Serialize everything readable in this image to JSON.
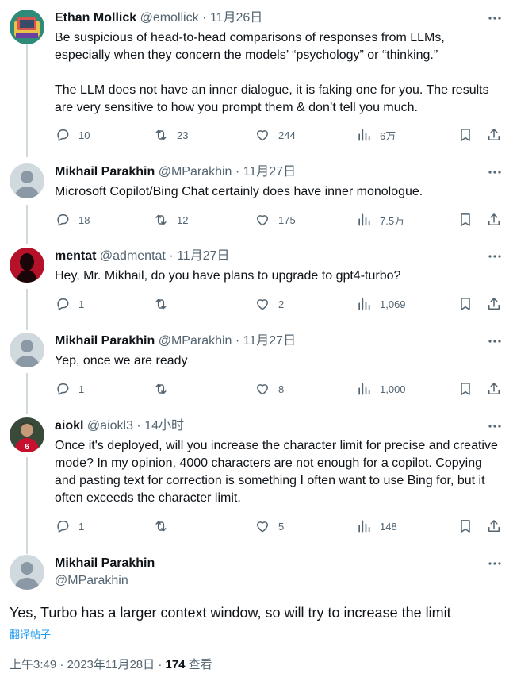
{
  "tweets": [
    {
      "name": "Ethan Mollick",
      "handle": "@emollick",
      "dot": "·",
      "time": "11月26日",
      "paragraphs": [
        "Be suspicious of head-to-head comparisons of responses from LLMs, especially when they concern the models’ “psychology” or “thinking.”",
        "The LLM does not have an inner dialogue, it is faking one for you. The results are very sensitive to how you prompt them & don’t tell you much."
      ],
      "replies": "10",
      "retweets": "23",
      "likes": "244",
      "views": "6万"
    },
    {
      "name": "Mikhail Parakhin",
      "handle": "@MParakhin",
      "dot": "·",
      "time": "11月27日",
      "paragraphs": [
        "Microsoft Copilot/Bing Chat certainly does have inner monologue."
      ],
      "replies": "18",
      "retweets": "12",
      "likes": "175",
      "views": "7.5万"
    },
    {
      "name": "mentat",
      "handle": "@admentat",
      "dot": "·",
      "time": "11月27日",
      "paragraphs": [
        "Hey, Mr. Mikhail, do you have plans to upgrade to gpt4-turbo?"
      ],
      "replies": "1",
      "retweets": "",
      "likes": "2",
      "views": "1,069"
    },
    {
      "name": "Mikhail Parakhin",
      "handle": "@MParakhin",
      "dot": "·",
      "time": "11月27日",
      "paragraphs": [
        "Yep, once we are ready"
      ],
      "replies": "1",
      "retweets": "",
      "likes": "8",
      "views": "1,000"
    },
    {
      "name": "aiokl",
      "handle": "@aiokl3",
      "dot": "·",
      "time": "14小时",
      "paragraphs": [
        "Once it's deployed, will you increase the character limit for precise and creative mode? In my opinion, 4000 characters are not enough for a copilot. Copying and pasting text for correction is something I often want to use Bing for, but it often exceeds the character limit."
      ],
      "replies": "1",
      "retweets": "",
      "likes": "5",
      "views": "148"
    }
  ],
  "main": {
    "name": "Mikhail Parakhin",
    "handle": "@MParakhin",
    "text": "Yes, Turbo has a larger context window, so will try to increase the limit",
    "translate": "翻译帖子",
    "time": "上午3:49 · 2023年11月28日 · ",
    "views_count": "174",
    "views_label": " 查看"
  },
  "icons": [
    "reply-icon",
    "retweet-icon",
    "like-icon",
    "views-icon",
    "bookmark-icon",
    "share-icon",
    "more-icon"
  ],
  "colors": {
    "text": "#0f1419",
    "secondary": "#536471",
    "link": "#1d9bf0",
    "thread_line": "#cfd9de"
  }
}
